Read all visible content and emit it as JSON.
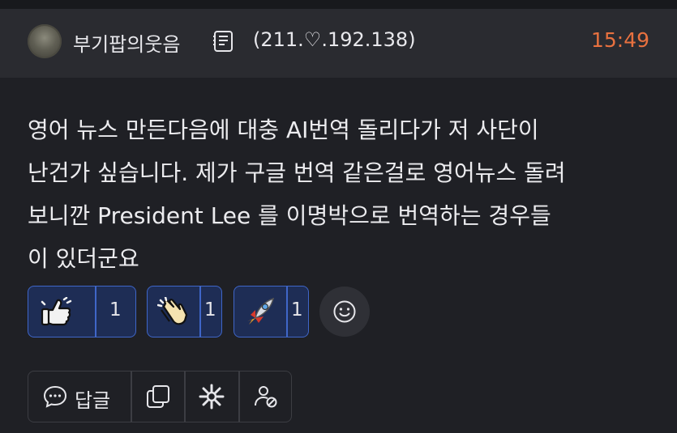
{
  "post": {
    "author": "부기팝의웃음",
    "ip": "(211.♡.192.138)",
    "time": "15:49",
    "lines": [
      "영어 뉴스 만든다음에 대충 AI번역 돌리다가 저  사단이",
      "난건가 싶습니다. 제가 구글 번역 같은걸로 영어뉴스 돌려",
      "보니깐 President Lee 를 이명박으로 번역하는 경우들",
      "이 있더군요"
    ]
  },
  "reactions": [
    {
      "icon": "thumbs-up-icon",
      "count": "1"
    },
    {
      "icon": "clapping-hands-icon",
      "count": "1"
    },
    {
      "icon": "rocket-icon",
      "count": "1"
    }
  ],
  "toolbar": {
    "reply_label": "답글",
    "icons": [
      "comment-icon",
      "copy-icon",
      "sparkle-icon",
      "user-block-icon"
    ]
  },
  "colors": {
    "background": "#1f2025",
    "header": "#2a2b30",
    "time_accent": "#e8713f",
    "reaction_border": "#3f66c8",
    "reaction_fill": "#1e2d55"
  }
}
